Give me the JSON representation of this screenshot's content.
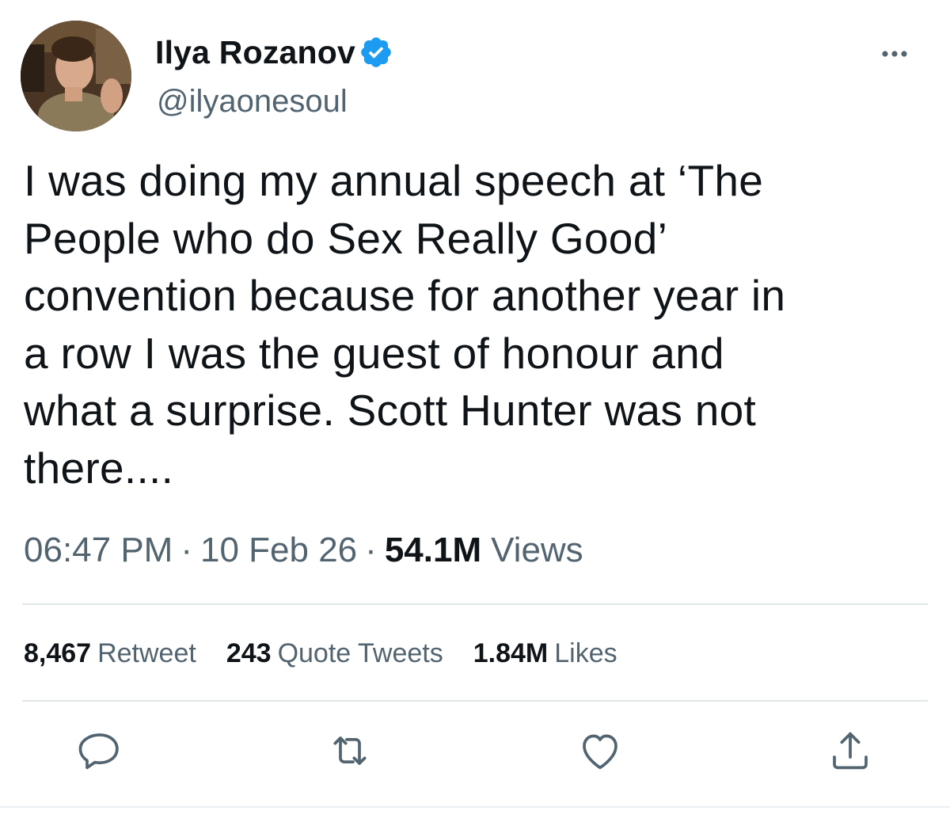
{
  "user": {
    "display_name": "Ilya Rozanov",
    "handle": "@ilyaonesoul",
    "verified": true,
    "avatar_icon": "profile-photo"
  },
  "tweet": {
    "text": "I was doing my annual speech at ‘The\nPeople who do Sex Really Good’\nconvention because for another year in\na row I was the guest of honour and\nwhat a surprise. Scott Hunter was not\nthere....",
    "time": "06:47 PM",
    "separator": "·",
    "date": "10 Feb 26",
    "views_count": "54.1M",
    "views_label": "Views"
  },
  "stats": {
    "retweets": {
      "count": "8,467",
      "label": "Retweet"
    },
    "quotes": {
      "count": "243",
      "label": "Quote Tweets"
    },
    "likes": {
      "count": "1.84M",
      "label": "Likes"
    }
  },
  "actions": [
    "reply-icon",
    "retweet-icon",
    "like-icon",
    "share-icon"
  ],
  "colors": {
    "text": "#0f1419",
    "secondary": "#536471",
    "verified": "#1d9bf0",
    "divider": "#e1e6ea"
  }
}
